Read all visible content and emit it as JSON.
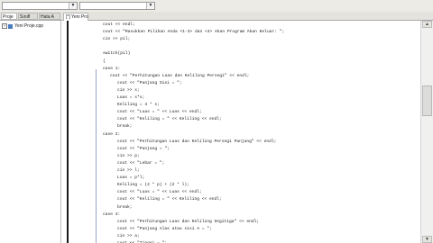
{
  "toolbar": {
    "combo1_value": "",
    "combo2_value": ""
  },
  "left_panel": {
    "tabs": [
      "Proje",
      "Sınıfl",
      "Hata A"
    ],
    "tree_item_label": "Yeni Proje.cpp"
  },
  "editor": {
    "active_tab": "[*] Yeni Pro"
  },
  "code_lines": [
    "cout << endl;",
    "cout << \"Masukkan Pilihan Anda <1-3> dan <4> Akan Program Akan Keluar: \";",
    "cin >> pil;",
    "",
    "switch(pil)",
    "{",
    "case 1:",
    "cout << \"Perhitungan Luas dan Keliling Persegi\" << endl;",
    "cout << \"Panjang Sisi = \";",
    "cin >> s;",
    "Luas = s*s;",
    "Keliling = 4 * s;",
    "cout << \"Luas = \" << Luas << endl;",
    "cout << \"Keliling = \" << Keliling << endl;",
    "break;",
    "case 2:",
    "cout << \"Perhitungan Luas dan Keliling Persegi Panjang\" << endl;",
    "cout << \"Panjang = \";",
    "cin >> p;",
    "cout << \"Lebar = \";",
    "cin >> l;",
    "Luas = p*l;",
    "Keliling = (2 * p) + (2 * l);",
    "cout << \"Luas = \" << Luas << endl;",
    "cout << \"Keliling = \" << Keliling << endl;",
    "break;",
    "case 3:",
    "cout << \"Perhitungan Luas dan Keliling Segitiga\" << endl;",
    "cout << \"Panjang Alas atau sisi A = \";",
    "cin >> a;",
    "cout << \"Tinggi = \";"
  ],
  "colors": {
    "marker_bar": "#1a1a1a",
    "fold_line": "#9aa6c9",
    "toolbar_bg": "#ecebe6"
  }
}
